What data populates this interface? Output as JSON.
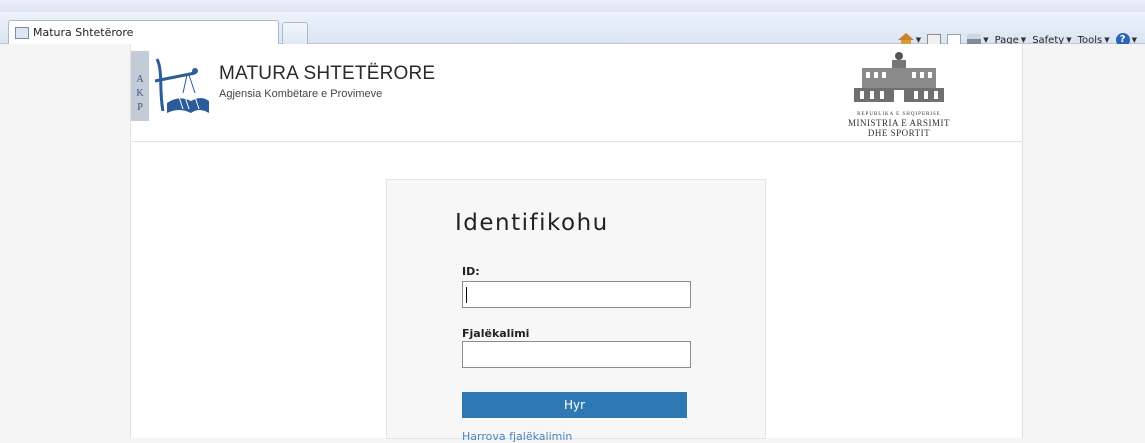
{
  "browser": {
    "tab_title": "Matura Shtetërore",
    "commands": {
      "page": "Page",
      "safety": "Safety",
      "tools": "Tools"
    }
  },
  "header": {
    "logo_letters": [
      "A",
      "K",
      "P"
    ],
    "title": "MATURA SHTETËRORE",
    "subtitle": "Agjensia Kombëtare e Provimeve",
    "ministry_small": "REPUBLIKA E SHQIPERISE",
    "ministry_line1": "MINISTRIA E ARSIMIT",
    "ministry_line2": "DHE SPORTIT"
  },
  "login": {
    "heading": "Identifikohu",
    "id_label": "ID:",
    "id_value": "",
    "password_label": "Fjalëkalimi",
    "password_value": "",
    "submit_label": "Hyr",
    "forgot_link": "Harrova fjalëkalimin"
  },
  "colors": {
    "button": "#2e79b3",
    "link": "#4a84bd"
  }
}
